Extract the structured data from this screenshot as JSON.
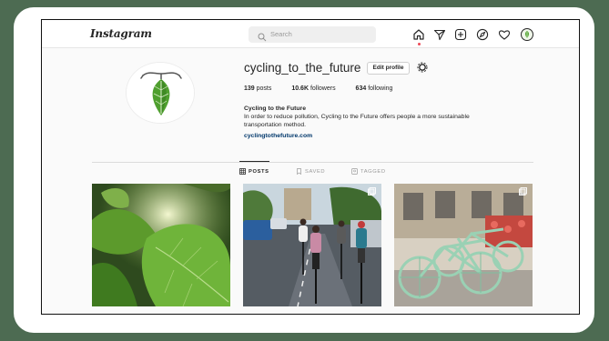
{
  "header": {
    "logo": "Instagram",
    "search_placeholder": "Search"
  },
  "nav_icons": [
    "home-icon",
    "direct-send-icon",
    "new-post-icon",
    "explore-compass-icon",
    "activity-heart-icon",
    "profile-avatar-icon"
  ],
  "profile": {
    "username": "cycling_to_the_future",
    "edit_button": "Edit profile",
    "posts_count": "139",
    "posts_label": "posts",
    "followers_count": "10.6K",
    "followers_label": "followers",
    "following_count": "634",
    "following_label": "following",
    "full_name": "Cycling to the Future",
    "bio_line1": "In order to reduce pollution, Cycling to the Future offers people a more sustainable",
    "bio_line2": "transportation method.",
    "link": "cyclingtothefuture.com"
  },
  "tabs": [
    {
      "label": "POSTS",
      "active": true
    },
    {
      "label": "SAVED",
      "active": false
    },
    {
      "label": "TAGGED",
      "active": false
    }
  ],
  "posts": [
    {
      "subject": "green leaves"
    },
    {
      "subject": "group of cyclists on road"
    },
    {
      "subject": "mint green bicycles parked"
    }
  ],
  "colors": {
    "background": "#4d6b52",
    "accent_green": "#5aa83a",
    "link": "#00376b",
    "notification": "#ed4956"
  }
}
